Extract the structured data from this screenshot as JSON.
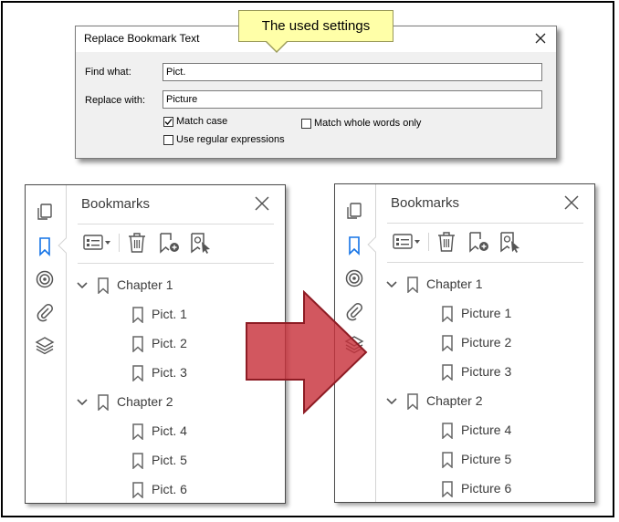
{
  "callout": {
    "text": "The used settings"
  },
  "dialog": {
    "title": "Replace Bookmark Text",
    "find_label": "Find what:",
    "find_value": "Pict.",
    "replace_label": "Replace with:",
    "replace_value": "Picture",
    "options": {
      "match_case": {
        "label": "Match case",
        "checked": true
      },
      "match_whole_words": {
        "label": "Match whole words only",
        "checked": false
      },
      "use_regex": {
        "label": "Use regular expressions",
        "checked": false
      }
    }
  },
  "panel_before": {
    "title": "Bookmarks",
    "items": [
      {
        "label": "Chapter 1",
        "level": 0
      },
      {
        "label": "Pict. 1",
        "level": 1
      },
      {
        "label": "Pict. 2",
        "level": 1
      },
      {
        "label": "Pict. 3",
        "level": 1
      },
      {
        "label": "Chapter 2",
        "level": 0
      },
      {
        "label": "Pict. 4",
        "level": 1
      },
      {
        "label": "Pict. 5",
        "level": 1
      },
      {
        "label": "Pict. 6",
        "level": 1
      }
    ]
  },
  "panel_after": {
    "title": "Bookmarks",
    "items": [
      {
        "label": "Chapter 1",
        "level": 0
      },
      {
        "label": "Picture 1",
        "level": 1
      },
      {
        "label": "Picture 2",
        "level": 1
      },
      {
        "label": "Picture 3",
        "level": 1
      },
      {
        "label": "Chapter 2",
        "level": 0
      },
      {
        "label": "Picture 4",
        "level": 1
      },
      {
        "label": "Picture 5",
        "level": 1
      },
      {
        "label": "Picture 6",
        "level": 1
      }
    ]
  },
  "colors": {
    "accent": "#1473e6",
    "arrow_fill": "#c8323c",
    "callout_bg": "#ffffa8"
  },
  "icons": {
    "rail": [
      "pages-icon",
      "bookmark-icon",
      "target-icon",
      "attachment-icon",
      "layers-icon"
    ],
    "toolbar": [
      "options-menu-icon",
      "delete-icon",
      "new-bookmark-icon",
      "new-bookmark-from-structure-icon"
    ]
  }
}
